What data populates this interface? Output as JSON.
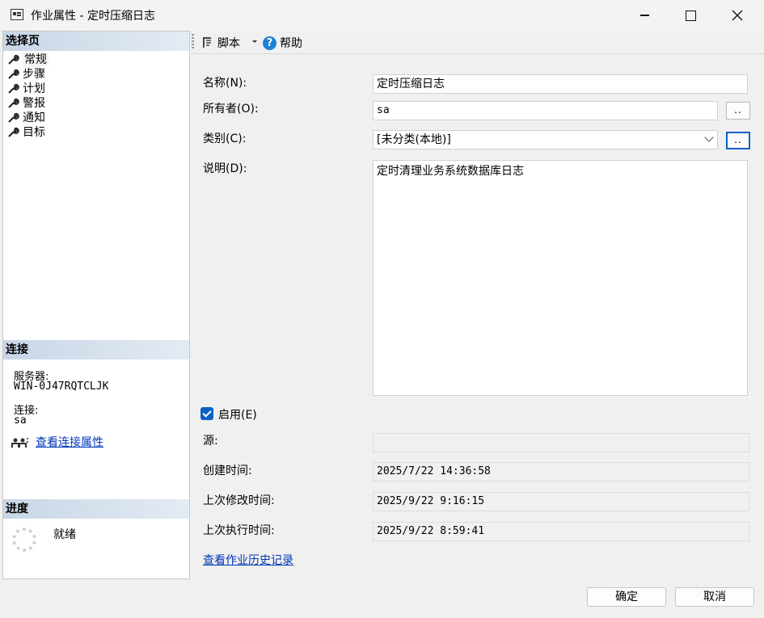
{
  "window": {
    "title": "作业属性 - 定时压缩日志"
  },
  "left": {
    "select_page_header": "选择页",
    "pages": [
      {
        "label": "常规",
        "selected": true
      },
      {
        "label": "步骤"
      },
      {
        "label": "计划"
      },
      {
        "label": "警报"
      },
      {
        "label": "通知"
      },
      {
        "label": "目标"
      }
    ],
    "connection_header": "连接",
    "server_label": "服务器:",
    "server_value": "WIN-0J47RQTCLJK",
    "connection_label": "连接:",
    "connection_value": "sa",
    "view_connection_link": "查看连接属性",
    "progress_header": "进度",
    "progress_status": "就绪"
  },
  "toolbar": {
    "script_label": "脚本",
    "help_label": "帮助"
  },
  "form": {
    "name_label": "名称(N):",
    "name_value": "定时压缩日志",
    "owner_label": "所有者(O):",
    "owner_value": "sa",
    "category_label": "类别(C):",
    "category_value": "[未分类(本地)]",
    "description_label": "说明(D):",
    "description_value": "定时清理业务系统数据库日志",
    "enabled_label": "启用(E)",
    "enabled": true,
    "source_label": "源:",
    "source_value": "",
    "created_label": "创建时间:",
    "created_value": "2025/7/22 14:36:58",
    "modified_label": "上次修改时间:",
    "modified_value": "2025/9/22 9:16:15",
    "executed_label": "上次执行时间:",
    "executed_value": "2025/9/22 8:59:41",
    "history_link": "查看作业历史记录",
    "browse_label": ".."
  },
  "buttons": {
    "ok": "确定",
    "cancel": "取消"
  },
  "colors": {
    "accent": "#0b5fc6",
    "link": "#0037b6",
    "header_gradient_start": "#c8d6e6"
  }
}
